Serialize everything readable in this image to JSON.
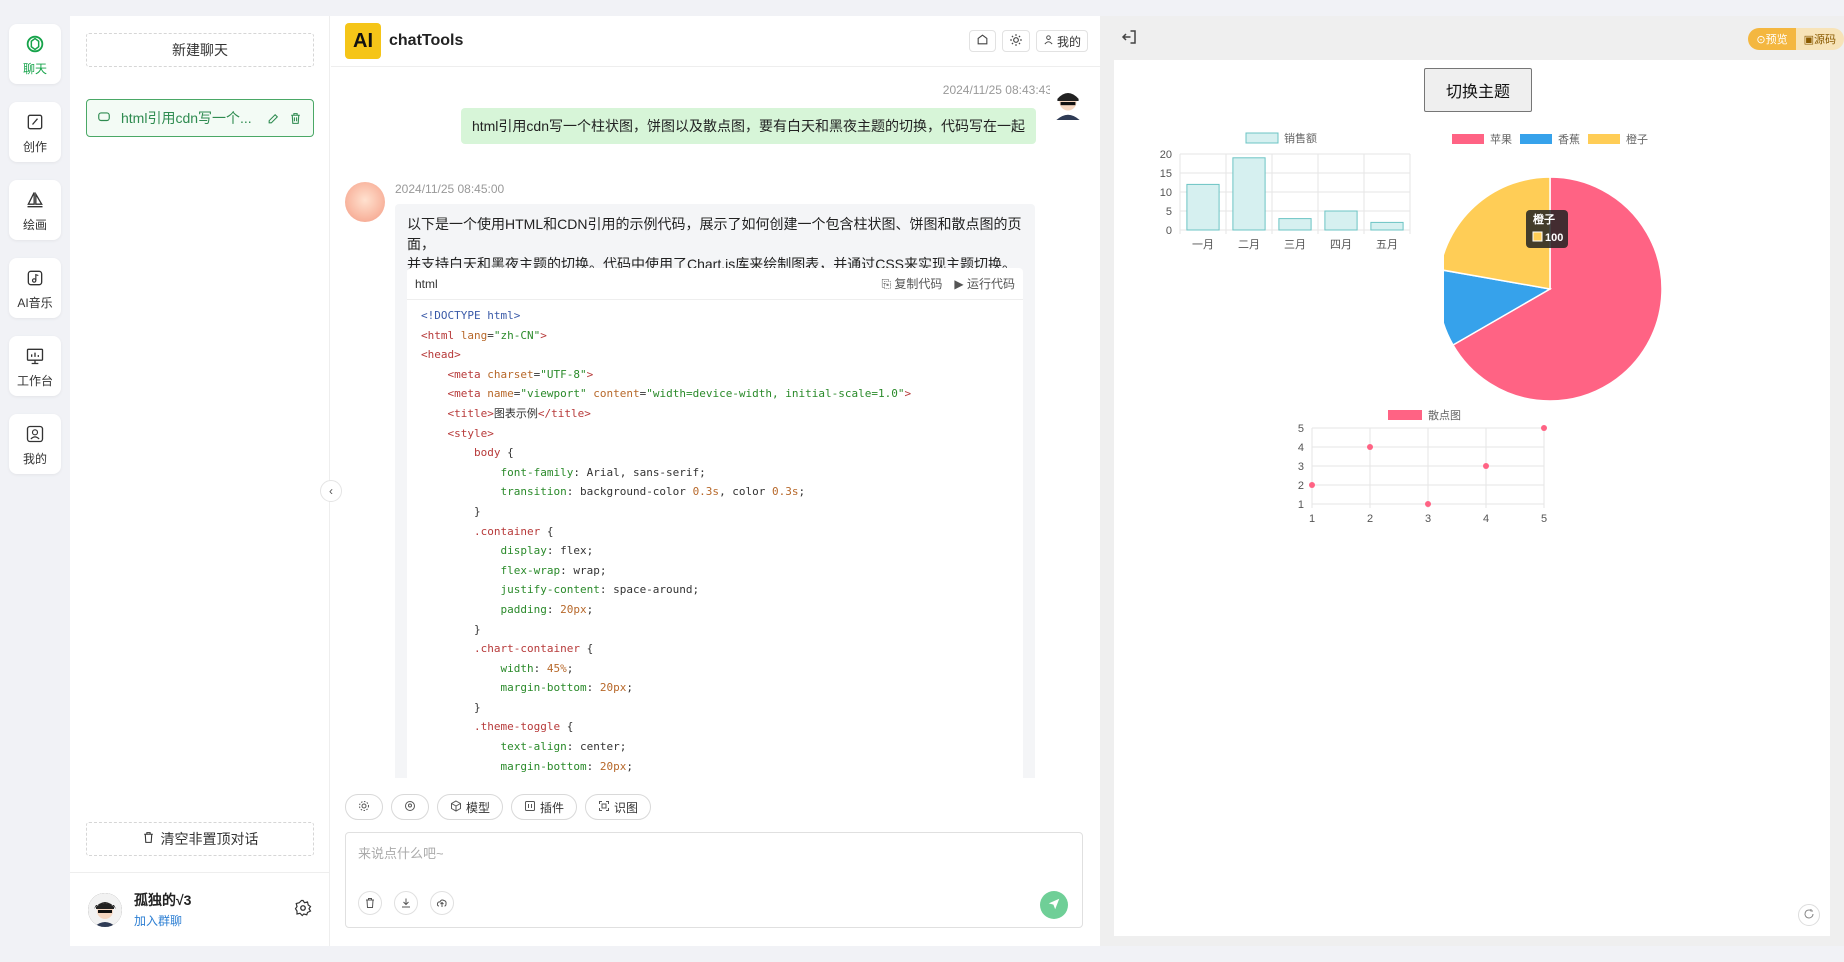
{
  "rail": {
    "items": [
      {
        "label": "聊天",
        "icon": "openai-icon"
      },
      {
        "label": "创作",
        "icon": "edit-icon"
      },
      {
        "label": "绘画",
        "icon": "sail-icon"
      },
      {
        "label": "AI音乐",
        "icon": "music-icon"
      },
      {
        "label": "工作台",
        "icon": "monitor-icon"
      },
      {
        "label": "我的",
        "icon": "user-icon"
      }
    ]
  },
  "sidebar": {
    "new_chat": "新建聊天",
    "conversation": "html引用cdn写一个...",
    "clear": "清空非置顶对话",
    "user_name": "孤独的√3",
    "user_link": "加入群聊"
  },
  "header": {
    "logo": "AI",
    "title": "chatTools",
    "me": "我的"
  },
  "messages": {
    "user_time": "2024/11/25 08:43:43",
    "user_text": "html引用cdn写一个柱状图，饼图以及散点图，要有白天和黑夜主题的切换，代码写在一起",
    "ai_time": "2024/11/25 08:45:00",
    "ai_text_1": "以下是一个使用HTML和CDN引用的示例代码，展示了如何创建一个包含柱状图、饼图和散点图的页面，",
    "ai_text_2": "并支持白天和黑夜主题的切换。代码中使用了Chart.js库来绘制图表，并通过CSS来实现主题切换。",
    "code_lang": "html",
    "copy": "复制代码",
    "run": "运行代码"
  },
  "tools": {
    "model": "模型",
    "plugin": "插件",
    "vision": "识图"
  },
  "input": {
    "placeholder": "来说点什么吧~"
  },
  "preview": {
    "mode_on": "预览",
    "mode_off": "源码",
    "theme_button": "切换主题"
  },
  "chart_data": [
    {
      "type": "bar",
      "categories": [
        "一月",
        "二月",
        "三月",
        "四月",
        "五月"
      ],
      "series": [
        {
          "name": "销售额",
          "values": [
            12,
            19,
            3,
            5,
            2
          ]
        }
      ],
      "ylim": [
        0,
        20
      ],
      "yticks": [
        0,
        5,
        10,
        15,
        20
      ],
      "legend": "top",
      "colors": {
        "fill": "#d6f0f0",
        "stroke": "#6cc4c4"
      }
    },
    {
      "type": "pie",
      "labels": [
        "苹果",
        "香蕉",
        "橙子"
      ],
      "values": [
        300,
        50,
        100
      ],
      "colors": [
        "#ff6384",
        "#36a2eb",
        "#ffcd56"
      ],
      "legend": "top",
      "tooltip": {
        "label": "橙子",
        "value": "100"
      }
    },
    {
      "type": "scatter",
      "series": [
        {
          "name": "散点图",
          "points": [
            [
              1,
              2
            ],
            [
              2,
              4
            ],
            [
              3,
              1
            ],
            [
              4,
              3
            ],
            [
              5,
              5
            ]
          ]
        }
      ],
      "xlim": [
        1,
        5
      ],
      "ylim": [
        1,
        5
      ],
      "legend": "top",
      "colors": {
        "point": "#ff6384"
      }
    }
  ]
}
